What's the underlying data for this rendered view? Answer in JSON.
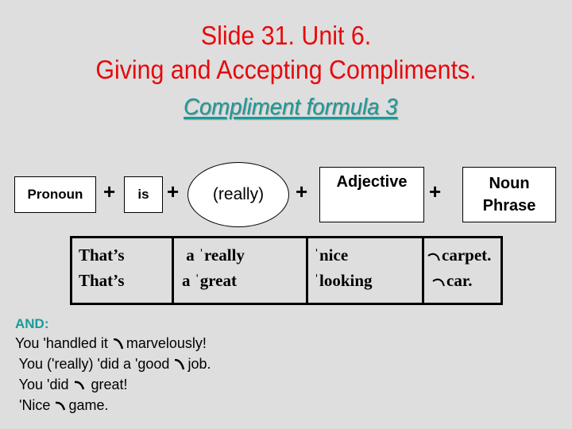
{
  "slide": {
    "title_line1": "Slide 31. Unit 6.",
    "title_line2": "Giving and Accepting Compliments.",
    "subtitle": "Compliment formula 3",
    "colors": {
      "title": "#e8080c",
      "accent": "#1a9a98",
      "background": "#dedede"
    }
  },
  "formula": {
    "pronoun": "Pronoun",
    "plus": "+",
    "is": "is",
    "really": "(really)",
    "adjective": "Adjective",
    "noun_line1": "Noun",
    "noun_line2": "Phrase"
  },
  "example_table": {
    "col1": [
      "That’s",
      "That’s"
    ],
    "col2": [
      " a ˈreally",
      "a ˈgreat"
    ],
    "col3": [
      "ˈnice",
      "ˈlooking"
    ],
    "col4": [
      "carpet.",
      "car."
    ]
  },
  "examples": {
    "heading": "AND:",
    "lines": [
      {
        "before": "You 'handled it ",
        "after": "marvelously!"
      },
      {
        "before": " You ('really) 'did a 'good ",
        "after": "job."
      },
      {
        "before": " You 'did ",
        "after": " great!"
      },
      {
        "before": " 'Nice ",
        "after": "game."
      }
    ]
  }
}
